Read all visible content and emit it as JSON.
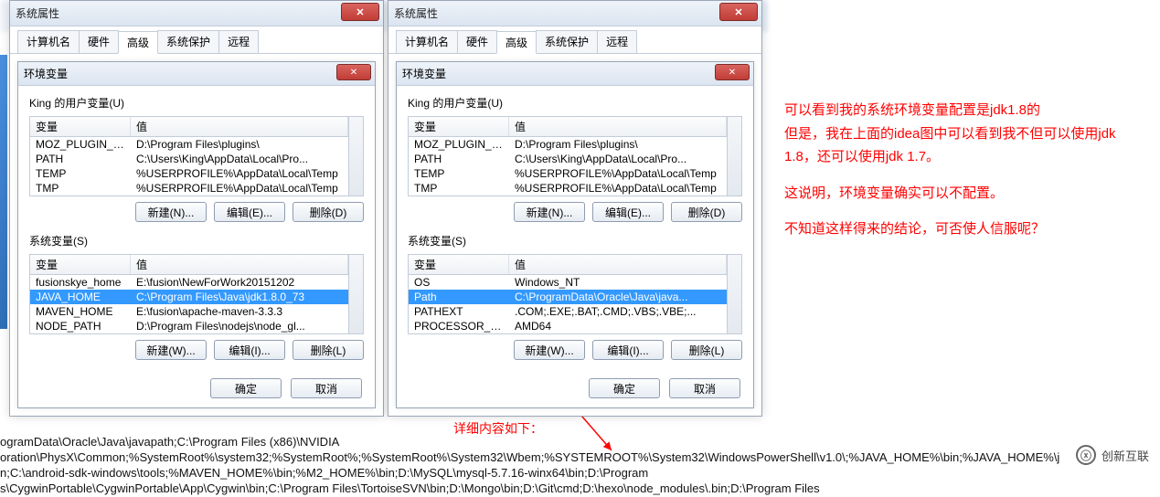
{
  "outer_dialog": {
    "title": "系统属性",
    "tabs": [
      "计算机名",
      "硬件",
      "高级",
      "系统保护",
      "远程"
    ],
    "active_tab": "高级"
  },
  "inner_dialog": {
    "title": "环境变量"
  },
  "left": {
    "user_group": "King 的用户变量(U)",
    "user_cols": {
      "var": "变量",
      "val": "值"
    },
    "user_rows": [
      {
        "var": "MOZ_PLUGIN_PATH",
        "val": "D:\\Program Files\\plugins\\"
      },
      {
        "var": "PATH",
        "val": "C:\\Users\\King\\AppData\\Local\\Pro..."
      },
      {
        "var": "TEMP",
        "val": "%USERPROFILE%\\AppData\\Local\\Temp"
      },
      {
        "var": "TMP",
        "val": "%USERPROFILE%\\AppData\\Local\\Temp"
      }
    ],
    "sys_group": "系统变量(S)",
    "sys_cols": {
      "var": "变量",
      "val": "值"
    },
    "sys_rows": [
      {
        "var": "fusionskye_home",
        "val": "E:\\fusion\\NewForWork20151202"
      },
      {
        "var": "JAVA_HOME",
        "val": "C:\\Program Files\\Java\\jdk1.8.0_73",
        "selected": true
      },
      {
        "var": "MAVEN_HOME",
        "val": "E:\\fusion\\apache-maven-3.3.3"
      },
      {
        "var": "NODE_PATH",
        "val": "D:\\Program Files\\nodejs\\node_gl..."
      }
    ],
    "user_btns": {
      "new": "新建(N)...",
      "edit": "编辑(E)...",
      "del": "删除(D)"
    },
    "sys_btns": {
      "new": "新建(W)...",
      "edit": "编辑(I)...",
      "del": "删除(L)"
    }
  },
  "right": {
    "user_group": "King 的用户变量(U)",
    "user_cols": {
      "var": "变量",
      "val": "值"
    },
    "user_rows": [
      {
        "var": "MOZ_PLUGIN_PATH",
        "val": "D:\\Program Files\\plugins\\"
      },
      {
        "var": "PATH",
        "val": "C:\\Users\\King\\AppData\\Local\\Pro..."
      },
      {
        "var": "TEMP",
        "val": "%USERPROFILE%\\AppData\\Local\\Temp"
      },
      {
        "var": "TMP",
        "val": "%USERPROFILE%\\AppData\\Local\\Temp"
      }
    ],
    "sys_group": "系统变量(S)",
    "sys_cols": {
      "var": "变量",
      "val": "值"
    },
    "sys_rows": [
      {
        "var": "OS",
        "val": "Windows_NT"
      },
      {
        "var": "Path",
        "val": "C:\\ProgramData\\Oracle\\Java\\java...",
        "selected": true
      },
      {
        "var": "PATHEXT",
        "val": ".COM;.EXE;.BAT;.CMD;.VBS;.VBE;..."
      },
      {
        "var": "PROCESSOR_AR...",
        "val": "AMD64"
      }
    ],
    "user_btns": {
      "new": "新建(N)...",
      "edit": "编辑(E)...",
      "del": "删除(D)"
    },
    "sys_btns": {
      "new": "新建(W)...",
      "edit": "编辑(I)...",
      "del": "删除(L)"
    }
  },
  "footer_btns": {
    "ok": "确定",
    "cancel": "取消"
  },
  "annotation": {
    "p1": "可以看到我的系统环境变量配置是jdk1.8的",
    "p2": "但是，我在上面的idea图中可以看到我不但可以使用jdk 1.8，还可以使用jdk 1.7。",
    "p3": "这说明，环境变量确实可以不配置。",
    "p4": "不知道这样得来的结论，可否使人信服呢？",
    "detail": "详细内容如下："
  },
  "path_block": {
    "l1": "ogramData\\Oracle\\Java\\javapath;C:\\Program Files (x86)\\NVIDIA",
    "l2": "oration\\PhysX\\Common;%SystemRoot%\\system32;%SystemRoot%;%SystemRoot%\\System32\\Wbem;%SYSTEMROOT%\\System32\\WindowsPowerShell\\v1.0\\;%JAVA_HOME%\\bin;%JAVA_HOME%\\j",
    "l3": "n;C:\\android-sdk-windows\\tools;%MAVEN_HOME%\\bin;%M2_HOME%\\bin;D:\\MySQL\\mysql-5.7.16-winx64\\bin;D:\\Program",
    "l4": "s\\CygwinPortable\\CygwinPortable\\App\\Cygwin\\bin;C:\\Program Files\\TortoiseSVN\\bin;D:\\Mongo\\bin;D:\\Git\\cmd;D:\\hexo\\node_modules\\.bin;D:\\Program Files"
  },
  "logo": "创新互联"
}
